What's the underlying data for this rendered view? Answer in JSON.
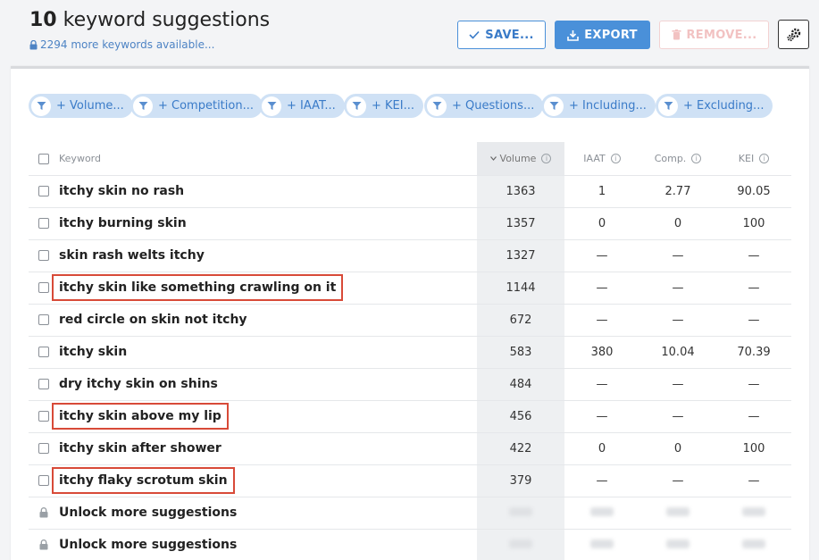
{
  "header": {
    "count": "10",
    "title_rest": "keyword suggestions",
    "subtitle": "2294 more keywords available...",
    "save_label": "SAVE...",
    "export_label": "EXPORT",
    "remove_label": "REMOVE..."
  },
  "filters": [
    {
      "label": "+ Volume..."
    },
    {
      "label": "+ Competition..."
    },
    {
      "label": "+ IAAT..."
    },
    {
      "label": "+ KEI..."
    },
    {
      "label": "+ Questions..."
    },
    {
      "label": "+ Including..."
    },
    {
      "label": "+ Excluding..."
    }
  ],
  "table": {
    "headers": {
      "keyword": "Keyword",
      "volume": "Volume",
      "iaat": "IAAT",
      "comp": "Comp.",
      "kei": "KEI"
    },
    "rows": [
      {
        "keyword": "itchy skin no rash",
        "volume": "1363",
        "iaat": "1",
        "comp": "2.77",
        "kei": "90.05"
      },
      {
        "keyword": "itchy burning skin",
        "volume": "1357",
        "iaat": "0",
        "comp": "0",
        "kei": "100"
      },
      {
        "keyword": "skin rash welts itchy",
        "volume": "1327",
        "iaat": "—",
        "comp": "—",
        "kei": "—"
      },
      {
        "keyword": "itchy skin like something crawling on it",
        "volume": "1144",
        "iaat": "—",
        "comp": "—",
        "kei": "—"
      },
      {
        "keyword": "red circle on skin not itchy",
        "volume": "672",
        "iaat": "—",
        "comp": "—",
        "kei": "—"
      },
      {
        "keyword": "itchy skin",
        "volume": "583",
        "iaat": "380",
        "comp": "10.04",
        "kei": "70.39"
      },
      {
        "keyword": "dry itchy skin on shins",
        "volume": "484",
        "iaat": "—",
        "comp": "—",
        "kei": "—"
      },
      {
        "keyword": "itchy skin above my lip",
        "volume": "456",
        "iaat": "—",
        "comp": "—",
        "kei": "—"
      },
      {
        "keyword": "itchy skin after shower",
        "volume": "422",
        "iaat": "0",
        "comp": "0",
        "kei": "100"
      },
      {
        "keyword": "itchy flaky scrotum skin",
        "volume": "379",
        "iaat": "—",
        "comp": "—",
        "kei": "—"
      }
    ],
    "unlock_label": "Unlock more suggestions"
  },
  "colors": {
    "accent": "#4a90d9",
    "highlight": "#d84a38",
    "remove": "#f2c2c2"
  }
}
